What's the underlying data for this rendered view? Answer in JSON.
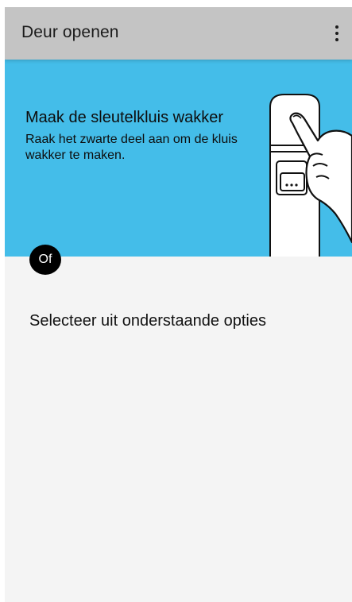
{
  "appbar": {
    "title": "Deur openen",
    "menu_icon": "more-vert-icon"
  },
  "hero": {
    "title": "Maak de sleutelkluis wakker",
    "text": "Raak het zwarte deel aan om de kluis wakker te maken.",
    "illustration": "keysafe-hand-illustration",
    "background_color": "#44bde9"
  },
  "divider_badge": {
    "label": "Of"
  },
  "options": {
    "heading": "Selecteer uit onderstaande opties"
  },
  "colors": {
    "appbar": "#c4c4c4",
    "hero": "#44bde9",
    "content_background": "#f4f4f4",
    "badge": "#000000"
  }
}
